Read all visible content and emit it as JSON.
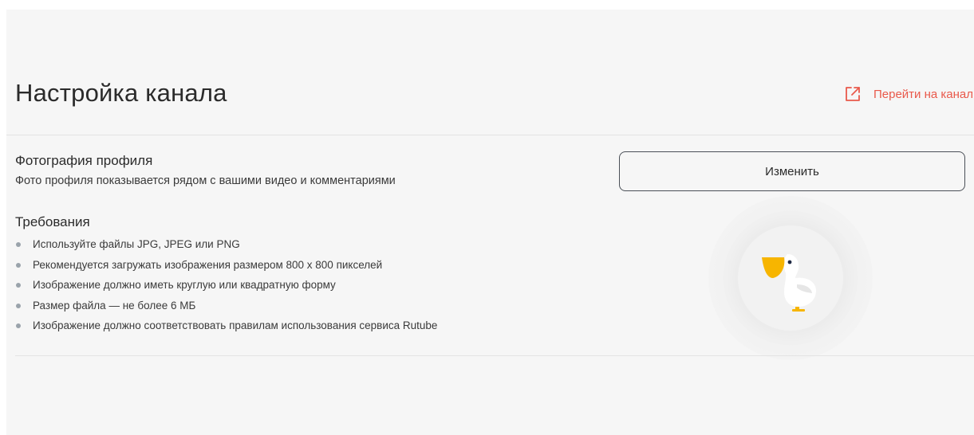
{
  "header": {
    "title": "Настройка канала",
    "goto_channel_label": "Перейти на канал",
    "goto_icon": "external-link-icon"
  },
  "profile_photo": {
    "title": "Фотография профиля",
    "description": "Фото профиля показывается рядом с вашими видео и комментариями",
    "change_button_label": "Изменить",
    "avatar_icon": "pelican-icon"
  },
  "requirements": {
    "title": "Требования",
    "items": [
      "Используйте файлы JPG, JPEG или PNG",
      "Рекомендуется загружать изображения размером 800 x 800 пикселей",
      "Изображение должно иметь круглую или квадратную форму",
      "Размер файла — не более 6 МБ",
      "Изображение должно соответствовать правилам использования сервиса Rutube"
    ]
  },
  "colors": {
    "accent": "#e9594b",
    "background": "#f6f6f6",
    "bullet": "#9aa3ab",
    "pelican_beak": "#f7b500"
  }
}
